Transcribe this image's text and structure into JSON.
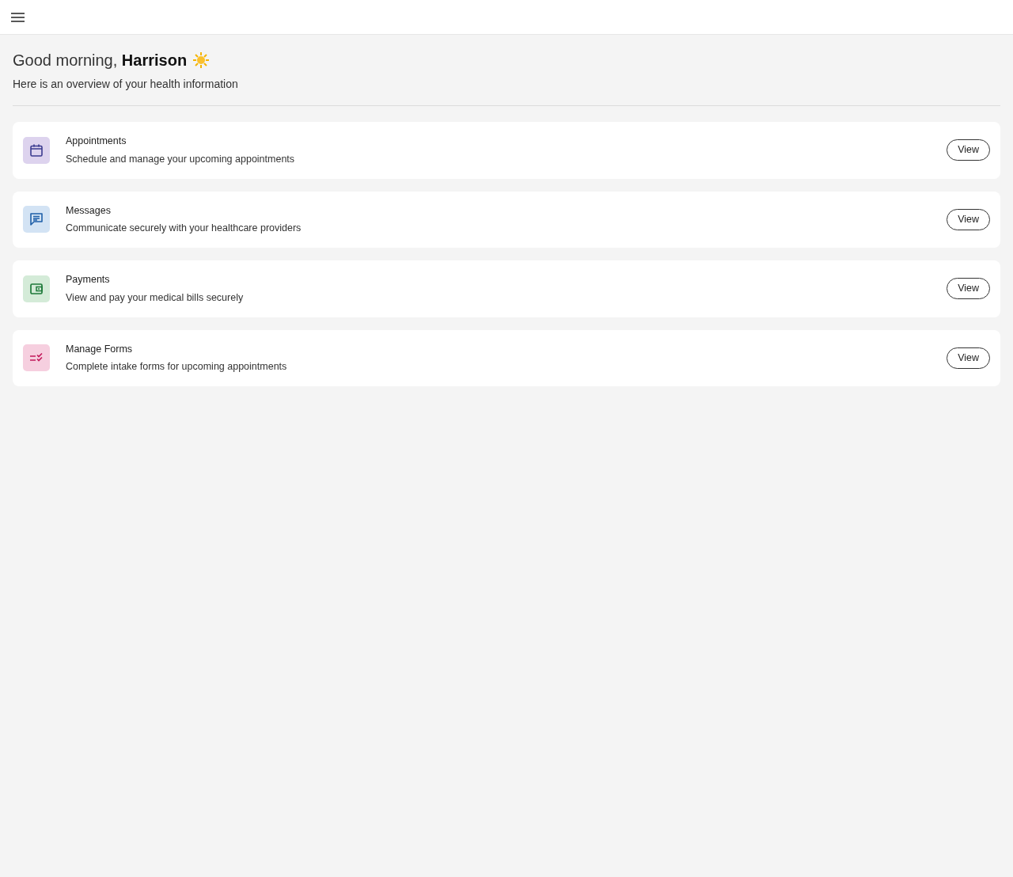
{
  "greeting": {
    "text": "Good morning, **Harrison**"
  },
  "subtitle": "Here is an overview of your health information",
  "cards": [
    {
      "kind": "calendar",
      "color": "#ddd3ee",
      "title": "Appointments",
      "description": "Schedule and manage your upcoming appointments",
      "button": "View"
    },
    {
      "kind": "chat",
      "color": "#d3e3f4",
      "title": "Messages",
      "description": "Communicate securely with your healthcare providers",
      "button": "View"
    },
    {
      "kind": "wallet",
      "color": "#d4ebd8",
      "title": "Payments",
      "description": "View and pay your medical bills securely",
      "button": "View"
    },
    {
      "kind": "checklist",
      "color": "#f6cfdf",
      "title": "Manage Forms",
      "description": "Complete intake forms for upcoming appointments",
      "button": "View"
    }
  ]
}
